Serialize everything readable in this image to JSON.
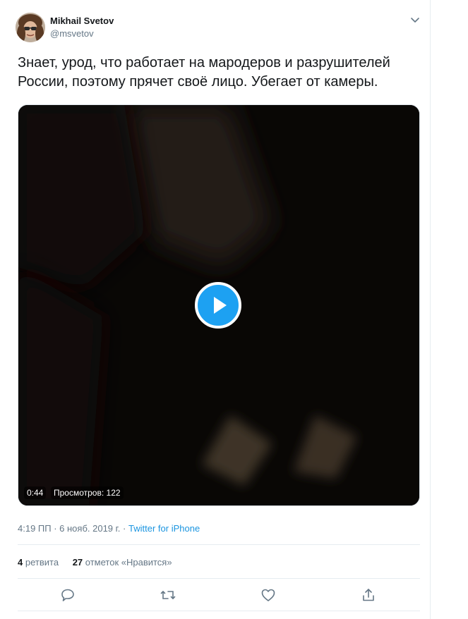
{
  "author": {
    "name": "Mikhail Svetov",
    "handle": "@msvetov"
  },
  "tweet": {
    "text": "Знает, урод, что работает на мародеров и разрушителей России, поэтому прячет своё лицо. Убегает от камеры."
  },
  "video": {
    "duration": "0:44",
    "views": "Просмотров: 122"
  },
  "meta": {
    "timestamp": "4:19 ПП · 6 нояб. 2019 г.",
    "separator": "·",
    "source": "Twitter for iPhone"
  },
  "stats": {
    "retweets_count": "4",
    "retweets_label": "ретвита",
    "likes_count": "27",
    "likes_label": "отметок «Нравится»"
  },
  "icons": {
    "caret": "chevron-down-icon",
    "reply": "reply-icon",
    "retweet": "retweet-icon",
    "like": "heart-icon",
    "share": "share-icon",
    "play": "play-icon"
  },
  "colors": {
    "accent": "#1da1f2",
    "link": "#1b95e0",
    "muted": "#657786",
    "text": "#14171a"
  }
}
